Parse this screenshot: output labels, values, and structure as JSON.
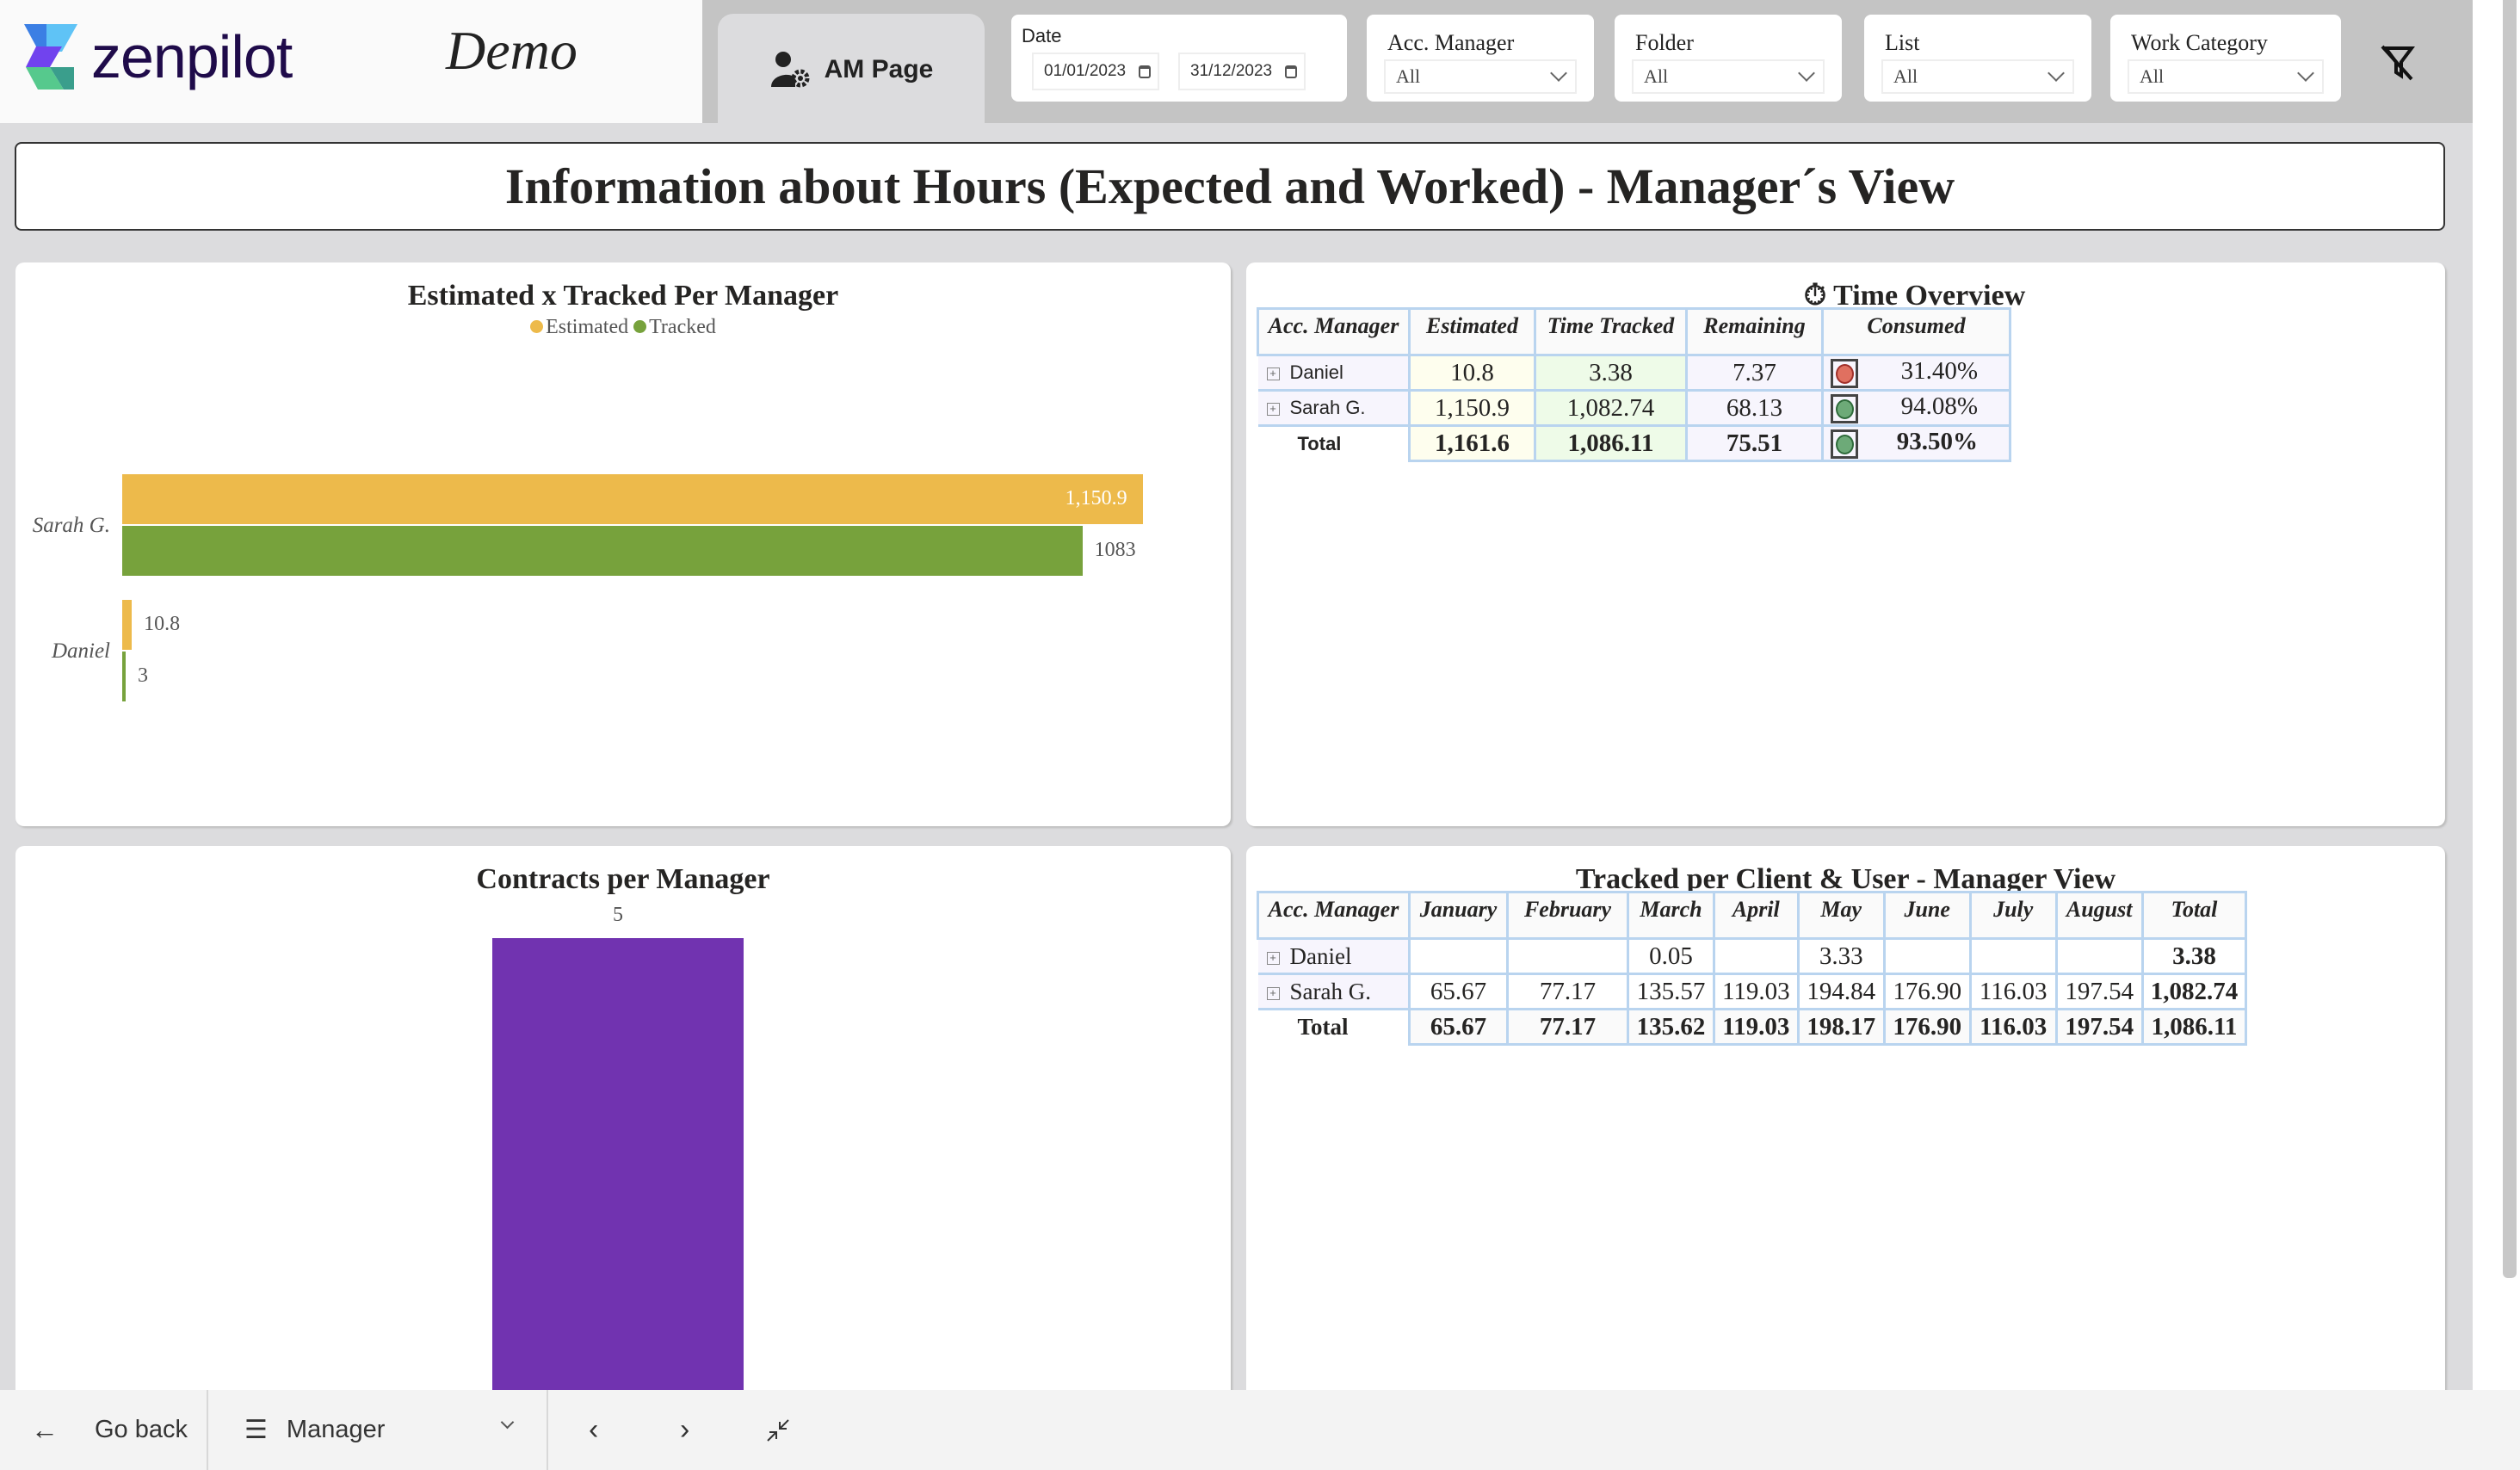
{
  "header": {
    "brand": "zenpilot",
    "subtitle": "Demo",
    "page_tab": {
      "label": "AM Page",
      "icon": "user-gear-icon"
    },
    "filters": {
      "date": {
        "label": "Date",
        "start": "01/01/2023",
        "end": "31/12/2023"
      },
      "acc_manager": {
        "label": "Acc. Manager",
        "value": "All"
      },
      "folder": {
        "label": "Folder",
        "value": "All"
      },
      "list": {
        "label": "List",
        "value": "All"
      },
      "work_category": {
        "label": "Work Category",
        "value": "All"
      }
    },
    "clear_filters_icon": "filter-clear-icon"
  },
  "page_title": "Information about Hours (Expected and Worked) - Manager´s View",
  "colors": {
    "estimated": "#EDBA4B",
    "tracked": "#77A23C",
    "contracts": "#7133B0",
    "kpi_red": "#E07060",
    "kpi_green": "#6DAA78",
    "table_border": "#B9D4EF"
  },
  "chart_data": [
    {
      "type": "bar",
      "orientation": "horizontal",
      "title": "Estimated x Tracked Per Manager",
      "categories": [
        "Sarah G.",
        "Daniel"
      ],
      "series": [
        {
          "name": "Estimated",
          "values": [
            1150.9
          ],
          "labels": [
            "1,150.9",
            "10.8"
          ],
          "all_values": [
            1150.9,
            10.8
          ]
        },
        {
          "name": "Tracked",
          "values": [
            1083
          ],
          "labels": [
            "1083",
            "3"
          ],
          "all_values": [
            1083,
            3
          ]
        }
      ],
      "legend": "top-center",
      "xlim": [
        0,
        1160
      ],
      "grid": false
    },
    {
      "type": "bar",
      "orientation": "vertical",
      "title": "Contracts per Manager",
      "categories": [
        ""
      ],
      "values": [
        5
      ],
      "labels": [
        "5"
      ],
      "ylim": [
        0,
        5
      ],
      "grid": false
    }
  ],
  "time_overview": {
    "title": "Time Overview",
    "icon": "stopwatch-icon",
    "columns": [
      "Acc. Manager",
      "Estimated",
      "Time Tracked",
      "Remaining",
      "Consumed"
    ],
    "rows": [
      {
        "name": "Daniel",
        "estimated": "10.8",
        "tracked": "3.38",
        "remaining": "7.37",
        "status": "red",
        "consumed": "31.40%"
      },
      {
        "name": "Sarah G.",
        "estimated": "1,150.9",
        "tracked": "1,082.74",
        "remaining": "68.13",
        "status": "green",
        "consumed": "94.08%"
      }
    ],
    "total": {
      "name": "Total",
      "estimated": "1,161.6",
      "tracked": "1,086.11",
      "remaining": "75.51",
      "status": "green",
      "consumed": "93.50%"
    }
  },
  "tracked_table": {
    "title": "Tracked per Client & User - Manager View",
    "columns": [
      "Acc. Manager",
      "January",
      "February",
      "March",
      "April",
      "May",
      "June",
      "July",
      "August",
      "Total"
    ],
    "rows": [
      {
        "name": "Daniel",
        "values": [
          "",
          "",
          "0.05",
          "",
          "3.33",
          "",
          "",
          "",
          "3.38"
        ]
      },
      {
        "name": "Sarah G.",
        "values": [
          "65.67",
          "77.17",
          "135.57",
          "119.03",
          "194.84",
          "176.90",
          "116.03",
          "197.54",
          "1,082.74"
        ]
      }
    ],
    "total": {
      "name": "Total",
      "values": [
        "65.67",
        "77.17",
        "135.62",
        "119.03",
        "198.17",
        "176.90",
        "116.03",
        "197.54",
        "1,086.11"
      ]
    }
  },
  "bottom_bar": {
    "go_back": "Go back",
    "page_selector": "Manager",
    "prev_icon": "chevron-left-icon",
    "next_icon": "chevron-right-icon",
    "collapse_icon": "collapse-icon"
  }
}
